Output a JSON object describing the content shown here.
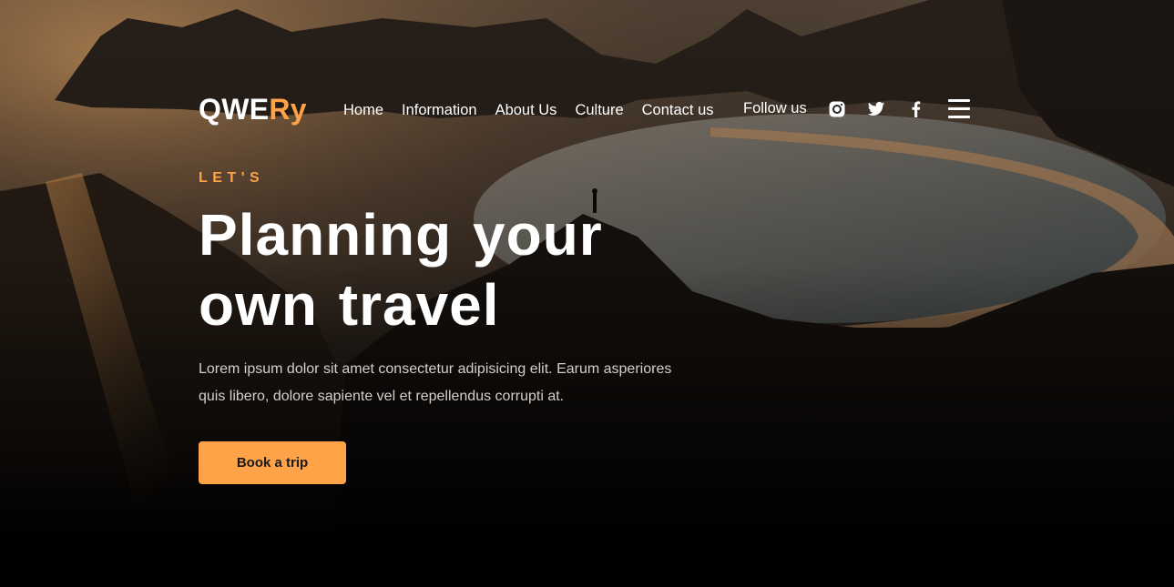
{
  "brand": {
    "logo_main": "QWE",
    "logo_accent": "Ry"
  },
  "nav": {
    "items": [
      {
        "label": "Home"
      },
      {
        "label": "Information"
      },
      {
        "label": "About Us"
      },
      {
        "label": "Culture"
      },
      {
        "label": "Contact us"
      }
    ]
  },
  "social": {
    "follow_label": "Follow us",
    "icons": [
      "instagram-icon",
      "twitter-icon",
      "facebook-icon"
    ],
    "menu_icon": "hamburger-menu-icon"
  },
  "hero": {
    "eyebrow": "LET'S",
    "headline": "Planning your own travel",
    "description": "Lorem ipsum dolor sit amet consectetur adipisicing elit. Earum asperiores quis libero, dolore sapiente vel et repellendus corrupti at.",
    "cta_label": "Book a trip"
  },
  "colors": {
    "accent": "#ffa348",
    "text": "#ffffff",
    "muted_text": "#d4cfca",
    "background": "#000000"
  }
}
